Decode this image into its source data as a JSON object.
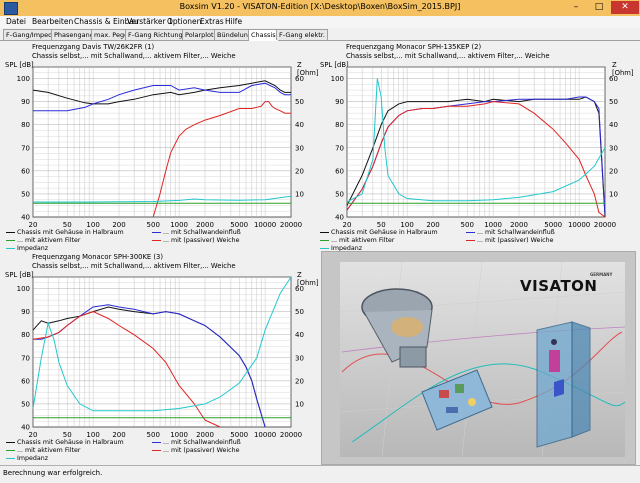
{
  "window": {
    "title": "Boxsim V1.20 - VISATON-Edition [X:\\Desktop\\Boxen\\BoxSim_2015.BPJ]"
  },
  "menu": [
    "Datei",
    "Bearbeiten",
    "Chassis & Einbau",
    "Verstärker 1",
    "Optionen",
    "Extras",
    "Hilfe"
  ],
  "tabs": [
    "F-Gang/Imped",
    "Phasengang",
    "max. Pegel",
    "F-Gang Richtungen",
    "Polarplots",
    "Bündelung",
    "Chassis",
    "F-Gang elektr."
  ],
  "active_tab": "Chassis",
  "status": "Berechnung war erfolgreich.",
  "logo": {
    "brand": "VISATON",
    "tag": "GERMANY"
  },
  "colors": {
    "black": "#111111",
    "blue": "#2b2bd8",
    "red": "#e02424",
    "cyan": "#22c8cc",
    "green": "#2aa02a"
  },
  "axis_labels": {
    "left": "SPL [dB]",
    "right": "Z [Ohm]"
  },
  "chart_data": [
    {
      "type": "line",
      "title": "Frequenzgang Davis TW/26K2FR (1)",
      "subtitle": "Chassis selbst,... mit Schallwand,... aktivem Filter,... Weiche",
      "xscale": "log",
      "xlim": [
        20,
        20000
      ],
      "xticks": [
        20,
        50,
        100,
        200,
        500,
        1000,
        2000,
        5000,
        10000,
        20000
      ],
      "xticklabels": [
        "20",
        "50",
        "100",
        "200",
        "500",
        "1000",
        "2000",
        "5000",
        "10000",
        "20000"
      ],
      "ylim": [
        40,
        105
      ],
      "yticks": [
        40,
        50,
        60,
        70,
        80,
        90,
        100
      ],
      "y2lim": [
        0,
        65
      ],
      "y2ticks": [
        10,
        20,
        30,
        40,
        50,
        60
      ],
      "legend": [
        {
          "label": "Chassis mit Gehäuse in Halbraum",
          "color": "black"
        },
        {
          "label": "... mit Schallwandeinfluß",
          "color": "blue"
        },
        {
          "label": "... mit aktivem Filter",
          "color": "green"
        },
        {
          "label": "... mit (passiver) Weiche",
          "color": "red"
        },
        {
          "label": "Impedanz",
          "color": "cyan"
        }
      ],
      "series": [
        {
          "name": "Chassis mit Gehäuse in Halbraum",
          "color": "black",
          "x": [
            20,
            30,
            50,
            80,
            100,
            150,
            200,
            300,
            500,
            800,
            1000,
            1500,
            2000,
            3000,
            5000,
            7000,
            10000,
            13000,
            15000,
            17000,
            20000
          ],
          "y": [
            95,
            94,
            91.5,
            89.5,
            89,
            89,
            90,
            91,
            93,
            94,
            93,
            94,
            95,
            96,
            97,
            98,
            99,
            97,
            95,
            94,
            94
          ]
        },
        {
          "name": "... mit Schallwandeinfluß",
          "color": "blue",
          "x": [
            20,
            30,
            50,
            80,
            100,
            150,
            200,
            300,
            500,
            800,
            1000,
            1500,
            2000,
            3000,
            5000,
            7000,
            10000,
            13000,
            15000,
            17000,
            20000
          ],
          "y": [
            86,
            86,
            86,
            87.5,
            89,
            91,
            93,
            95,
            97,
            97,
            95,
            96,
            95,
            94,
            94,
            97,
            98,
            96,
            94,
            93,
            93
          ]
        },
        {
          "name": "... mit (passiver) Weiche",
          "color": "red",
          "x": [
            500,
            600,
            700,
            800,
            1000,
            1200,
            1500,
            2000,
            3000,
            5000,
            7000,
            9000,
            10000,
            11000,
            12000,
            13000,
            15000,
            17000,
            20000
          ],
          "y": [
            40,
            50,
            60,
            68,
            75,
            78,
            80,
            82,
            84,
            87,
            87,
            88,
            90,
            90,
            88,
            87,
            86,
            85,
            85
          ]
        },
        {
          "name": "Impedanz",
          "color": "cyan",
          "axis": "right",
          "x": [
            20,
            50,
            100,
            200,
            500,
            1000,
            1500,
            2000,
            5000,
            10000,
            20000
          ],
          "y": [
            6.5,
            6.5,
            6.5,
            6.6,
            6.7,
            7.2,
            7.8,
            7.5,
            7.3,
            7.5,
            9
          ]
        },
        {
          "name": "Baseline",
          "color": "green",
          "x": [
            20,
            20000
          ],
          "y": [
            46,
            46
          ]
        }
      ]
    },
    {
      "type": "line",
      "title": "Frequenzgang Monacor SPH-135KEP (2)",
      "subtitle": "Chassis selbst,... mit Schallwand,... aktivem Filter,... Weiche",
      "xscale": "log",
      "xlim": [
        20,
        20000
      ],
      "xticks": [
        20,
        50,
        100,
        200,
        500,
        1000,
        2000,
        5000,
        10000,
        20000
      ],
      "xticklabels": [
        "20",
        "50",
        "100",
        "200",
        "500",
        "1000",
        "2000",
        "5000",
        "10000",
        "20000"
      ],
      "ylim": [
        40,
        105
      ],
      "yticks": [
        40,
        50,
        60,
        70,
        80,
        90,
        100
      ],
      "y2lim": [
        0,
        65
      ],
      "y2ticks": [
        10,
        20,
        30,
        40,
        50,
        60
      ],
      "legend": [
        {
          "label": "Chassis mit Gehäuse in Halbraum",
          "color": "black"
        },
        {
          "label": "... mit Schallwandeinfluß",
          "color": "blue"
        },
        {
          "label": "... mit aktivem Filter",
          "color": "green"
        },
        {
          "label": "... mit (passiver) Weiche",
          "color": "red"
        },
        {
          "label": "Impedanz",
          "color": "cyan"
        }
      ],
      "series": [
        {
          "name": "Chassis mit Gehäuse in Halbraum",
          "color": "black",
          "x": [
            20,
            30,
            40,
            50,
            60,
            80,
            100,
            150,
            200,
            300,
            500,
            800,
            1000,
            2000,
            3000,
            5000,
            7000,
            10000,
            12000,
            15000,
            17000,
            20000
          ],
          "y": [
            45,
            58,
            70,
            80,
            86,
            89,
            90,
            90,
            90,
            90,
            91,
            90,
            91,
            90,
            91,
            91,
            91,
            91,
            92,
            90,
            85,
            40
          ]
        },
        {
          "name": "... mit Schallwandeinfluß",
          "color": "blue",
          "x": [
            20,
            30,
            40,
            50,
            60,
            80,
            100,
            150,
            200,
            300,
            500,
            800,
            1000,
            2000,
            3000,
            5000,
            7000,
            10000,
            12000,
            15000,
            17000,
            20000
          ],
          "y": [
            43,
            52,
            62,
            72,
            79,
            84,
            86,
            87,
            87,
            88,
            89,
            90,
            90,
            91,
            91,
            91,
            91,
            92,
            92,
            90,
            87,
            41
          ]
        },
        {
          "name": "... mit (passiver) Weiche",
          "color": "red",
          "x": [
            20,
            30,
            40,
            50,
            60,
            80,
            100,
            150,
            200,
            300,
            500,
            800,
            1000,
            2000,
            3000,
            5000,
            7000,
            10000,
            12000,
            15000,
            17000,
            20000
          ],
          "y": [
            43,
            52,
            62,
            72,
            79,
            84,
            86,
            87,
            87,
            88,
            88,
            89,
            90,
            89,
            85,
            78,
            72,
            65,
            58,
            50,
            42,
            40
          ]
        },
        {
          "name": "Impedanz",
          "color": "cyan",
          "axis": "right",
          "x": [
            20,
            30,
            40,
            45,
            50,
            55,
            60,
            80,
            100,
            200,
            500,
            1000,
            2000,
            5000,
            10000,
            15000,
            20000
          ],
          "y": [
            6.5,
            10,
            25,
            60,
            52,
            30,
            18,
            10,
            8,
            7,
            7,
            7.5,
            8.5,
            11,
            16,
            22,
            30
          ]
        },
        {
          "name": "Baseline",
          "color": "green",
          "x": [
            20,
            20000
          ],
          "y": [
            46,
            46
          ]
        }
      ]
    },
    {
      "type": "line",
      "title": "Frequenzgang Monacor SPH-300KE (3)",
      "subtitle": "Chassis selbst,... mit Schallwand,... aktivem Filter,... Weiche",
      "xscale": "log",
      "xlim": [
        20,
        20000
      ],
      "xticks": [
        20,
        50,
        100,
        200,
        500,
        1000,
        2000,
        5000,
        10000,
        20000
      ],
      "xticklabels": [
        "20",
        "50",
        "100",
        "200",
        "500",
        "1000",
        "2000",
        "5000",
        "10000",
        "20000"
      ],
      "ylim": [
        40,
        105
      ],
      "yticks": [
        40,
        50,
        60,
        70,
        80,
        90,
        100
      ],
      "y2lim": [
        0,
        65
      ],
      "y2ticks": [
        10,
        20,
        30,
        40,
        50,
        60
      ],
      "legend": [
        {
          "label": "Chassis mit Gehäuse in Halbraum",
          "color": "black"
        },
        {
          "label": "... mit Schallwandeinfluß",
          "color": "blue"
        },
        {
          "label": "... mit aktivem Filter",
          "color": "green"
        },
        {
          "label": "... mit (passiver) Weiche",
          "color": "red"
        },
        {
          "label": "Impedanz",
          "color": "cyan"
        }
      ],
      "series": [
        {
          "name": "Chassis mit Gehäuse in Halbraum",
          "color": "black",
          "x": [
            20,
            25,
            30,
            40,
            50,
            70,
            100,
            150,
            200,
            300,
            500,
            700,
            1000,
            1500,
            2000,
            3000,
            5000,
            6000,
            7000,
            8000,
            10000
          ],
          "y": [
            82,
            86,
            85,
            86,
            87,
            88,
            90,
            92,
            91,
            90,
            89,
            90,
            89,
            86,
            84,
            79,
            71,
            66,
            60,
            52,
            40
          ]
        },
        {
          "name": "... mit Schallwandeinfluß",
          "color": "blue",
          "x": [
            20,
            25,
            30,
            40,
            50,
            70,
            100,
            150,
            200,
            300,
            500,
            700,
            1000,
            1500,
            2000,
            3000,
            5000,
            6000,
            7000,
            8000,
            10000
          ],
          "y": [
            78,
            78,
            79,
            81,
            84,
            88,
            92,
            93,
            92,
            91,
            89,
            90,
            89,
            86,
            84,
            79,
            71,
            66,
            60,
            52,
            40
          ]
        },
        {
          "name": "... mit (passiver) Weiche",
          "color": "red",
          "x": [
            20,
            30,
            40,
            50,
            70,
            100,
            150,
            200,
            300,
            500,
            700,
            1000,
            1500,
            2000,
            3000
          ],
          "y": [
            78,
            79,
            81,
            84,
            88,
            90,
            87,
            84,
            80,
            74,
            68,
            58,
            50,
            43,
            40
          ]
        },
        {
          "name": "Impedanz",
          "color": "cyan",
          "axis": "right",
          "x": [
            20,
            25,
            30,
            35,
            40,
            50,
            70,
            100,
            200,
            500,
            1000,
            2000,
            3000,
            5000,
            8000,
            10000,
            15000,
            20000
          ],
          "y": [
            8,
            30,
            45,
            38,
            28,
            18,
            10,
            7,
            7,
            7,
            8,
            10,
            13,
            19,
            30,
            42,
            58,
            65
          ]
        },
        {
          "name": "Baseline",
          "color": "green",
          "x": [
            20,
            20000
          ],
          "y": [
            44,
            44
          ]
        }
      ]
    }
  ]
}
